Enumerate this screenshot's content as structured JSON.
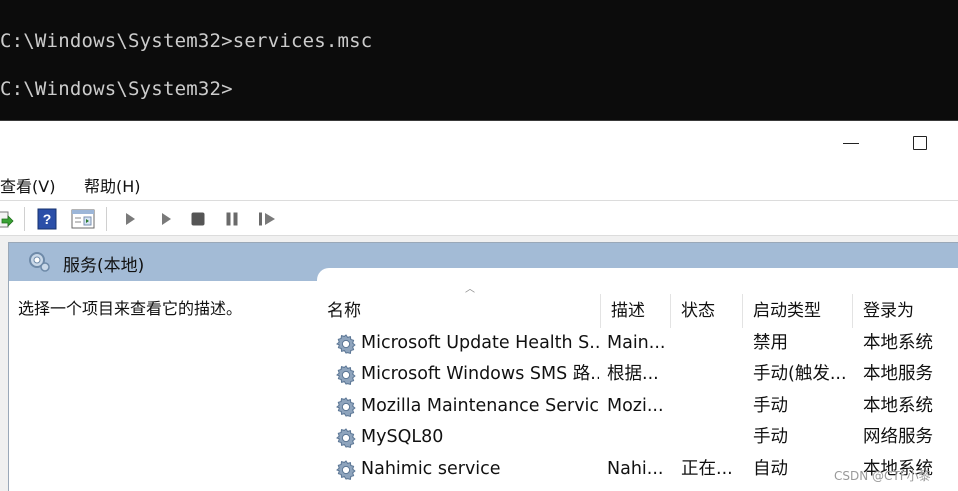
{
  "console": {
    "line1": "C:\\Windows\\System32>services.msc",
    "line2": "C:\\Windows\\System32>"
  },
  "menu": [
    {
      "label": "查看(V)"
    },
    {
      "label": "帮助(H)"
    }
  ],
  "panel": {
    "title": "服务(本地)",
    "description": "选择一个项目来查看它的描述。"
  },
  "columns": [
    "名称",
    "描述",
    "状态",
    "启动类型",
    "登录为"
  ],
  "rows": [
    {
      "name": "Microsoft Update Health S...",
      "desc": "Main...",
      "status": "",
      "startup": "禁用",
      "logon": "本地系统"
    },
    {
      "name": "Microsoft Windows SMS 路...",
      "desc": "根据...",
      "status": "",
      "startup": "手动(触发...",
      "logon": "本地服务"
    },
    {
      "name": "Mozilla Maintenance Service",
      "desc": "Mozi...",
      "status": "",
      "startup": "手动",
      "logon": "本地系统"
    },
    {
      "name": "MySQL80",
      "desc": "",
      "status": "",
      "startup": "手动",
      "logon": "网络服务"
    },
    {
      "name": "Nahimic service",
      "desc": "Nahi...",
      "status": "正在...",
      "startup": "自动",
      "logon": "本地系统"
    }
  ],
  "watermark": "CSDN @CTF小黎",
  "colors": {
    "console_bg": "#0c0c0c",
    "console_text": "#cccccc",
    "header_band": "#a3bbd6"
  },
  "icons": [
    "export-list-icon",
    "help-icon",
    "properties-view-icon",
    "start-service-icon",
    "start-service-alt-icon",
    "stop-service-icon",
    "pause-service-icon",
    "resume-service-icon",
    "gear-icon",
    "minimize-icon",
    "maximize-icon",
    "services-icon"
  ]
}
